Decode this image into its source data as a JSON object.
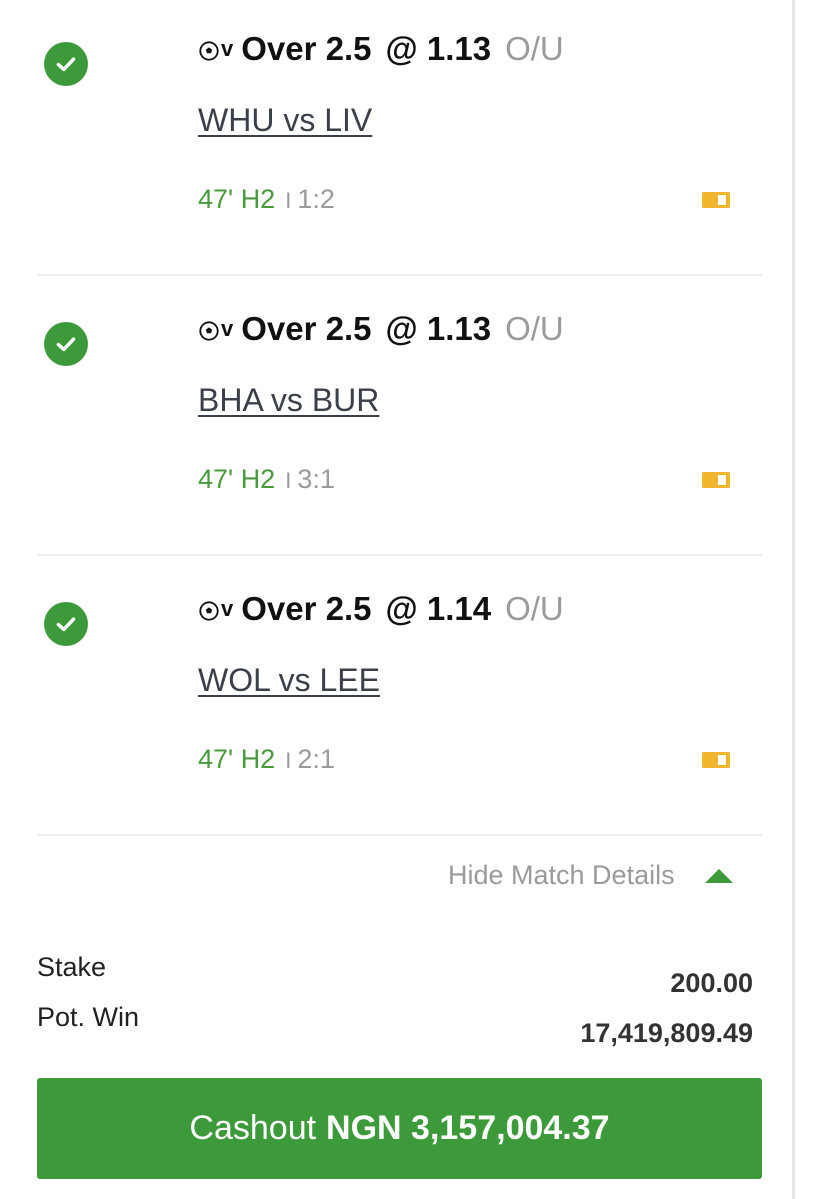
{
  "selections": [
    {
      "pick": "Over 2.5",
      "odds": "@ 1.13",
      "market": "O/U",
      "match": "WHU vs LIV",
      "time": "47' H2",
      "separator": "I",
      "score": "1:2",
      "status": "won"
    },
    {
      "pick": "Over 2.5",
      "odds": "@ 1.13",
      "market": "O/U",
      "match": "BHA vs BUR",
      "time": "47' H2",
      "separator": "I",
      "score": "3:1",
      "status": "won"
    },
    {
      "pick": "Over 2.5",
      "odds": "@ 1.14",
      "market": "O/U",
      "match": "WOL vs LEE",
      "time": "47' H2",
      "separator": "I",
      "score": "2:1",
      "status": "won"
    }
  ],
  "sport_icon": {
    "name": "soccer-ball-icon",
    "suffix": "v"
  },
  "toggle": {
    "label": "Hide Match Details",
    "icon": "triangle-up-icon"
  },
  "summary": {
    "stake_label": "Stake",
    "pot_win_label": "Pot. Win",
    "stake_value": "200.00",
    "pot_win_value": "17,419,809.49"
  },
  "cashout": {
    "label": "Cashout",
    "amount": "NGN 3,157,004.37"
  },
  "colors": {
    "accent_green": "#3d9a3a",
    "time_green": "#4a9a3c",
    "muted_gray": "#9a9a9a",
    "tag_yellow": "#f2b52e"
  }
}
